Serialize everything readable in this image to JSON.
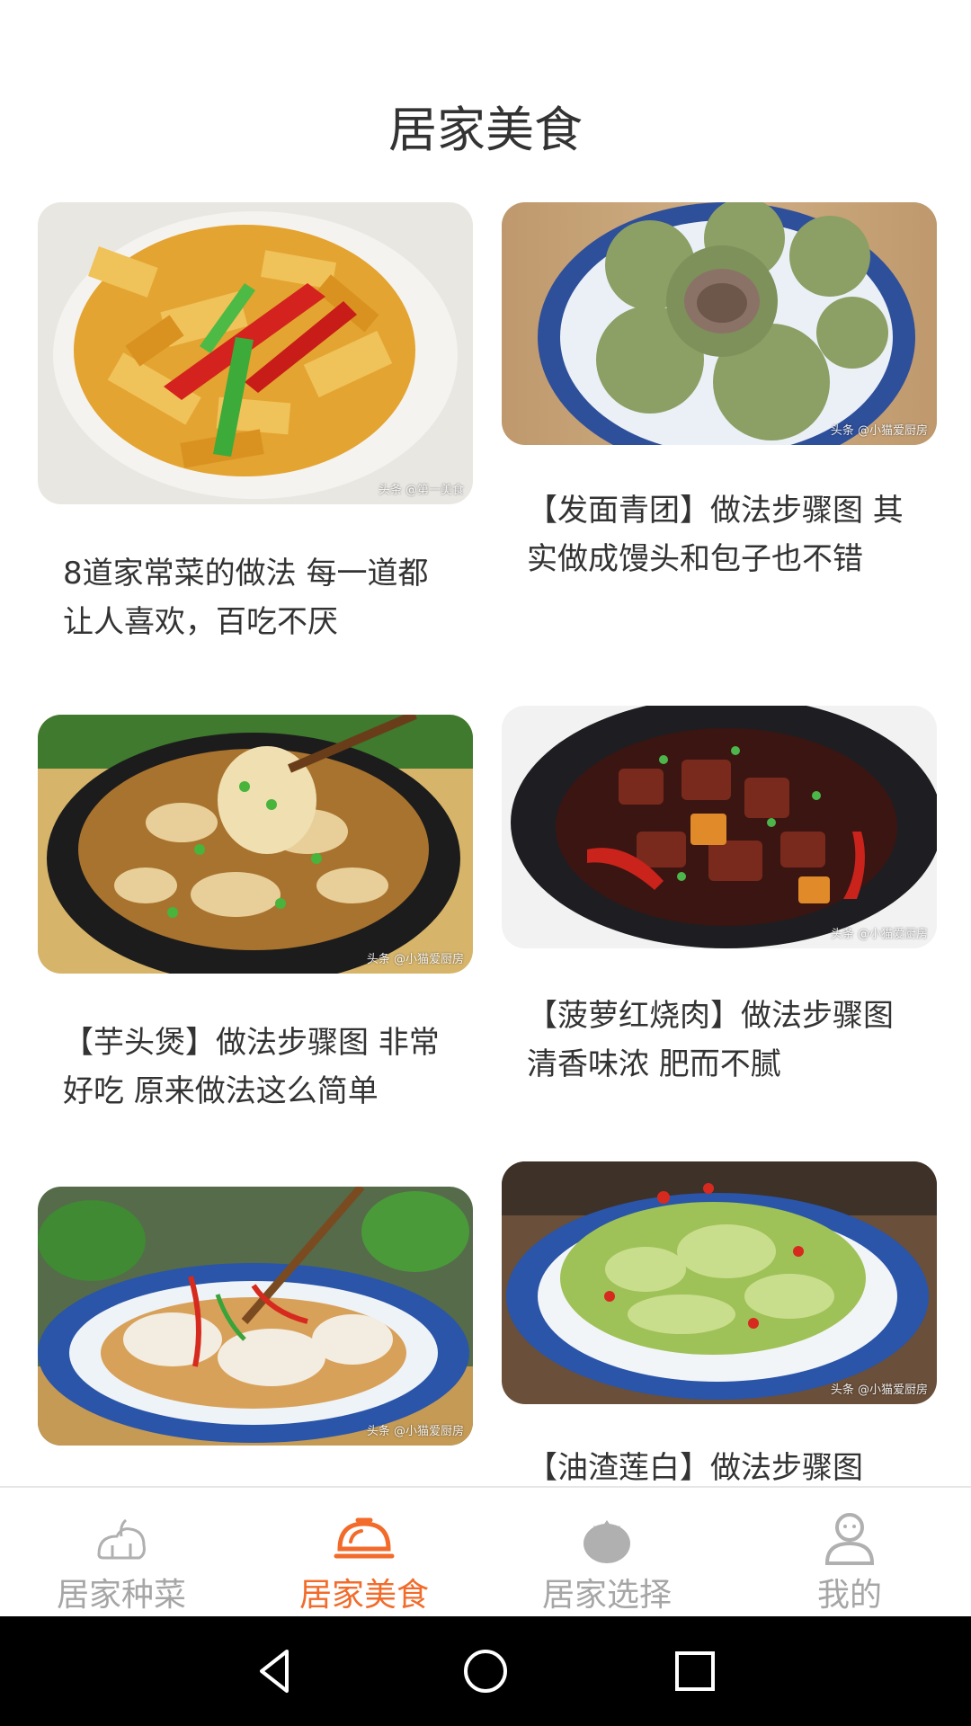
{
  "header": {
    "title": "居家美食"
  },
  "cards": [
    {
      "caption": "8道家常菜的做法 每一道都让人喜欢，百吃不厌",
      "watermark": "头条 @第一美食"
    },
    {
      "caption": "【发面青团】做法步骤图 其实做成馒头和包子也不错",
      "watermark": "头条 @小猫爱厨房"
    },
    {
      "caption": "【芋头煲】做法步骤图 非常好吃 原来做法这么简单",
      "watermark": "头条 @小猫爱厨房"
    },
    {
      "caption": "【菠萝红烧肉】做法步骤图 清香味浓 肥而不腻",
      "watermark": "头条 @小猫爱厨房"
    },
    {
      "caption": "",
      "watermark": "头条 @小猫爱厨房"
    },
    {
      "caption": "【油渣莲白】做法步骤图",
      "watermark": "头条 @小猫爱厨房"
    }
  ],
  "tabs": [
    {
      "label": "居家种菜",
      "icon": "vegetable-icon"
    },
    {
      "label": "居家美食",
      "icon": "cloche-icon",
      "active": true
    },
    {
      "label": "居家选择",
      "icon": "tomato-icon"
    },
    {
      "label": "我的",
      "icon": "user-icon"
    }
  ],
  "colors": {
    "accent": "#f26b2a",
    "inactive": "#a6a6a6"
  },
  "system_nav": [
    "back-icon",
    "home-icon",
    "recents-icon"
  ]
}
